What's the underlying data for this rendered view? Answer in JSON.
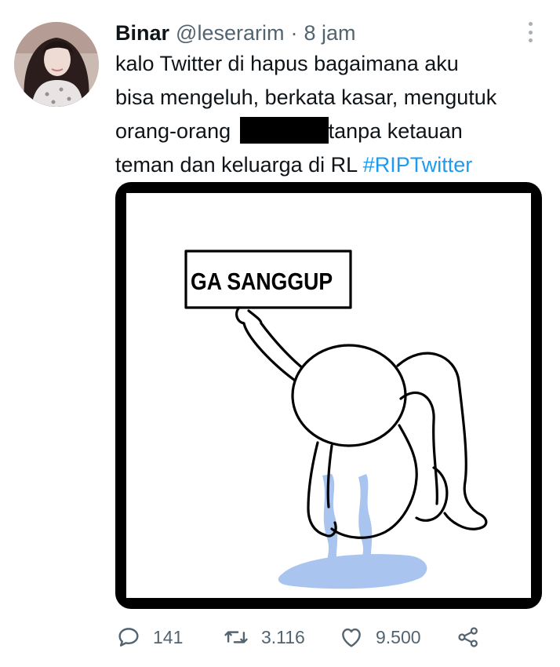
{
  "tweet": {
    "author_name": "Binar",
    "author_handle": "@leserarim",
    "separator": "·",
    "time": "8 jam",
    "text_line1": "kalo Twitter di hapus bagaimana aku",
    "text_line2": "bisa mengeluh, berkata kasar, mengutuk",
    "text_line3_before": "orang-orang",
    "text_line3_after": "tanpa ketauan",
    "text_line4": "teman dan keluarga di RL",
    "hashtag": "#RIPTwitter"
  },
  "media": {
    "sign_text": "GA SANGGUP",
    "tear_color": "#a9c4ef"
  },
  "actions": {
    "reply_count": "141",
    "retweet_count": "3.116",
    "like_count": "9.500",
    "icons": [
      "reply-icon",
      "retweet-icon",
      "like-icon",
      "share-icon"
    ]
  },
  "colors": {
    "text": "#0f1419",
    "secondary": "#536471",
    "link": "#1d9bf0"
  }
}
